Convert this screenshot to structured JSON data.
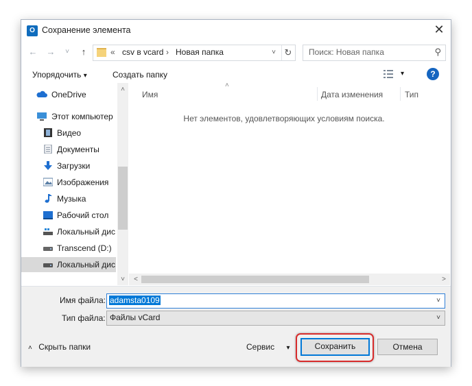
{
  "window": {
    "title": "Сохранение элемента",
    "app_icon": "outlook-icon",
    "close_glyph": "✕"
  },
  "nav": {
    "back_glyph": "←",
    "forward_glyph": "→",
    "recent_glyph": "˅",
    "up_glyph": "↑",
    "breadcrumb_prefix": "«",
    "breadcrumb": [
      "csv в vcard",
      "Новая папка"
    ],
    "breadcrumb_sep": "›",
    "refresh_glyph": "↻",
    "dropdown_glyph": "˅",
    "search_placeholder": "Поиск: Новая папка",
    "search_glyph": "⚲"
  },
  "toolbar": {
    "organize_label": "Упорядочить",
    "organize_arrow": "▾",
    "new_folder_label": "Создать папку",
    "view_arrow": "▾",
    "help_label": "?"
  },
  "sidebar": {
    "items": [
      {
        "label": "OneDrive",
        "icon": "cloud-icon",
        "color": "#1e6fd0"
      },
      {
        "label": "Этот компьютер",
        "icon": "computer-icon",
        "color": "#3a8fd8"
      },
      {
        "label": "Видео",
        "icon": "video-icon",
        "color": "#333333"
      },
      {
        "label": "Документы",
        "icon": "documents-icon",
        "color": "#6b7a8c"
      },
      {
        "label": "Загрузки",
        "icon": "downloads-icon",
        "color": "#1e6fd0"
      },
      {
        "label": "Изображения",
        "icon": "pictures-icon",
        "color": "#5b7fa6"
      },
      {
        "label": "Музыка",
        "icon": "music-icon",
        "color": "#1e6fd0"
      },
      {
        "label": "Рабочий стол",
        "icon": "desktop-icon",
        "color": "#1e6fd0"
      },
      {
        "label": "Локальный дис",
        "icon": "drive-icon",
        "color": "#555555"
      },
      {
        "label": "Transcend (D:)",
        "icon": "drive-icon",
        "color": "#555555"
      },
      {
        "label": "Локальный дис",
        "icon": "drive-icon",
        "color": "#555555"
      }
    ],
    "scroll_up": "˄",
    "scroll_down": "˅"
  },
  "file_list": {
    "sort_glyph": "˄",
    "columns": [
      "Имя",
      "Дата изменения",
      "Тип"
    ],
    "empty_message": "Нет элементов, удовлетворяющих условиям поиска.",
    "scroll_left": "<",
    "scroll_right": ">"
  },
  "form": {
    "filename_label": "Имя файла:",
    "filename_value": "adamsta0109",
    "filetype_label": "Тип файла:",
    "filetype_value": "Файлы vCard",
    "dropdown_glyph": "˅"
  },
  "footer": {
    "hide_folders_glyph": "˄",
    "hide_folders_label": "Скрыть папки",
    "service_label": "Сервис",
    "service_arrow": "▾",
    "save_label": "Сохранить",
    "cancel_label": "Отмена",
    "highlight_color": "#d72b2b"
  }
}
